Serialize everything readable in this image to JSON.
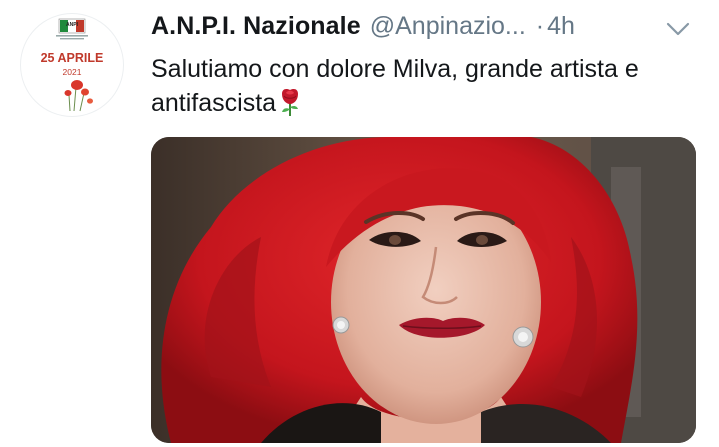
{
  "tweet": {
    "display_name": "A.N.P.I. Nazionale",
    "handle": "@Anpinazio...",
    "separator": "·",
    "time": "4h",
    "text": "Salutiamo con dolore Milva, grande artista e antifascista",
    "emoji": "rose-emoji"
  },
  "avatar": {
    "logo_text": "ANPI",
    "caption": "25 APRILE",
    "year": "2021",
    "accent": "#c0392b"
  },
  "media": {
    "subject": "portrait-photo"
  },
  "colors": {
    "text": "#14171a",
    "secondary": "#657786",
    "background": "#ffffff"
  },
  "icons": {
    "more": "chevron-down-icon"
  }
}
